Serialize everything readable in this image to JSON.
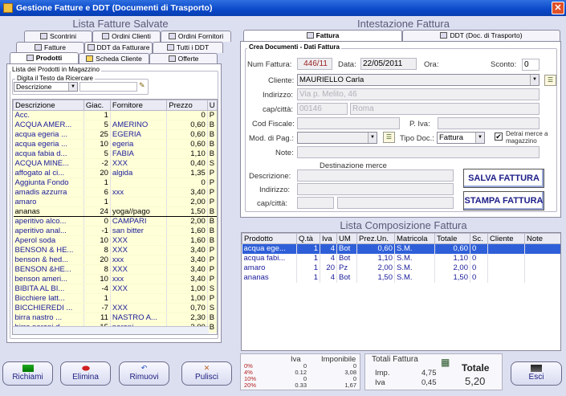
{
  "window": {
    "title": "Gestione Fatture e DDT (Documenti di Trasporto)",
    "close": "✕"
  },
  "left": {
    "title": "Lista Fatture Salvate",
    "tabs_row1": [
      "Scontrini",
      "Ordini Clienti",
      "Ordini Fornitori"
    ],
    "tabs_row2": [
      "Fatture",
      "DDT da Fatturare",
      "Tutti i DDT"
    ],
    "tabs_row3": [
      "Prodotti",
      "Scheda Cliente",
      "Offerte"
    ],
    "products_group_label": "Lista dei Prodotti in Magazzino",
    "search_group_label": "Digita il Testo da Ricercare",
    "search_field_select": "Descrizione",
    "search_value": "",
    "columns": [
      "Descrizione",
      "Giac.",
      "Fornitore",
      "Prezzo",
      "U"
    ],
    "rows": [
      [
        "Acc.",
        "1",
        "",
        "0",
        "P"
      ],
      [
        "ACQUA AMER...",
        "5",
        "AMERINO",
        "0,60",
        "B"
      ],
      [
        "acqua egeria ...",
        "25",
        "EGERIA",
        "0,60",
        "B"
      ],
      [
        "acqua egeria ...",
        "10",
        "egeria",
        "0,60",
        "B"
      ],
      [
        "acqua fabia d...",
        "5",
        "FABIA",
        "1,10",
        "B"
      ],
      [
        "ACQUA MINE...",
        "-2",
        "XXX",
        "0,40",
        "S"
      ],
      [
        "affogato al ci...",
        "20",
        "algida",
        "1,35",
        "P"
      ],
      [
        "Aggiunta Fondo",
        "1",
        "",
        "0",
        "P"
      ],
      [
        "amadis azzurra",
        "6",
        "xxx",
        "3,40",
        "P"
      ],
      [
        "amaro",
        "1",
        "",
        "2,00",
        "P"
      ],
      [
        "ananas",
        "24",
        "yoga//pago",
        "1,50",
        "B"
      ],
      [
        "aperitivo alco...",
        "0",
        "CAMPARI",
        "2,00",
        "B"
      ],
      [
        "aperitivo anal...",
        "-1",
        "san bitter",
        "1,60",
        "B"
      ],
      [
        "Aperol soda",
        "10",
        "XXX",
        "1,60",
        "B"
      ],
      [
        "BENSON & HE...",
        "8",
        "XXX",
        "3,40",
        "P"
      ],
      [
        "benson & hed...",
        "20",
        "xxx",
        "3,40",
        "P"
      ],
      [
        "BENSON &HE...",
        "8",
        "XXX",
        "3,40",
        "P"
      ],
      [
        "benson ameri...",
        "10",
        "xxx",
        "3,40",
        "P"
      ],
      [
        "BIBITA AL BI...",
        "-4",
        "XXX",
        "1,00",
        "S"
      ],
      [
        "Bicchiere latt...",
        "1",
        "",
        "1,00",
        "P"
      ],
      [
        "BICCHIEREDI ...",
        "-7",
        "XXX",
        "0,70",
        "S"
      ],
      [
        "birra  nastro ...",
        "11",
        "NASTRO A...",
        "2,30",
        "B"
      ],
      [
        "birra peroni d...",
        "15",
        "peroni",
        "2,00",
        "B"
      ]
    ]
  },
  "right": {
    "title": "Intestazione Fattura",
    "tabs": [
      "Fattura",
      "DDT (Doc. di Trasporto)"
    ],
    "group_label": "Crea Documenti - Dati Fattura",
    "labels": {
      "num": "Num Fattura:",
      "data": "Data:",
      "ora": "Ora:",
      "sconto": "Sconto:",
      "cliente": "Cliente:",
      "indirizzo": "Indirizzo:",
      "cap": "cap/città:",
      "codfisc": "Cod Fiscale:",
      "piva": "P. Iva:",
      "modpag": "Mod. di Pag.:",
      "tipodoc": "Tipo Doc.:",
      "detrai": "Detrai merce a magazzino",
      "note": "Note:",
      "dest_title": "Destinazione merce",
      "dest_descr": "Descrizione:",
      "dest_ind": "Indirizzo:",
      "dest_cap": "cap/città:"
    },
    "values": {
      "num": "446/11",
      "data": "22/05/2011",
      "ora": "",
      "sconto": "0",
      "cliente": "MAURIELLO Carla",
      "indirizzo": "Via p.  Melito, 46",
      "cap": "00146",
      "citta": "Roma",
      "tipodoc": "Fattura",
      "detrai": "✔"
    },
    "buttons": {
      "salva": "SALVA FATTURA",
      "stampa": "STAMPA FATTURA"
    }
  },
  "composition": {
    "title": "Lista Composizione Fattura",
    "columns": [
      "Prodotto",
      "Q.tà",
      "Iva",
      "UM",
      "Prez.Un.",
      "Matricola",
      "Totale",
      "Sc.",
      "Cliente",
      "Note"
    ],
    "rows": [
      [
        "acqua ege...",
        "1",
        "4",
        "Bot",
        "0,60",
        "S.M.",
        "0,60",
        "0",
        "",
        ""
      ],
      [
        "acqua fabi...",
        "1",
        "4",
        "Bot",
        "1,10",
        "S.M.",
        "1,10",
        "0",
        "",
        ""
      ],
      [
        "amaro",
        "1",
        "20",
        "Pz",
        "2,00",
        "S.M.",
        "2,00",
        "0",
        "",
        ""
      ],
      [
        "ananas",
        "1",
        "4",
        "Bot",
        "1,50",
        "S.M.",
        "1,50",
        "0",
        "",
        ""
      ]
    ]
  },
  "vat": {
    "iva_label": "Iva",
    "imp_label": "Imponibile",
    "rows": [
      [
        "4%",
        "0.12",
        "3,08"
      ],
      [
        "10%",
        "0",
        "0"
      ],
      [
        "20%",
        "0.33",
        "1,67"
      ]
    ],
    "extra": [
      "0%",
      "0",
      "0"
    ]
  },
  "totals": {
    "title": "Totali Fattura",
    "imp_label": "Imp.",
    "imp": "4,75",
    "iva_label": "Iva",
    "iva": "0,45",
    "tot_label": "Totale",
    "tot": "5,20"
  },
  "bottom_buttons": [
    "Richiami",
    "Elimina",
    "Rimuovi",
    "Pulisci",
    "Esci"
  ]
}
